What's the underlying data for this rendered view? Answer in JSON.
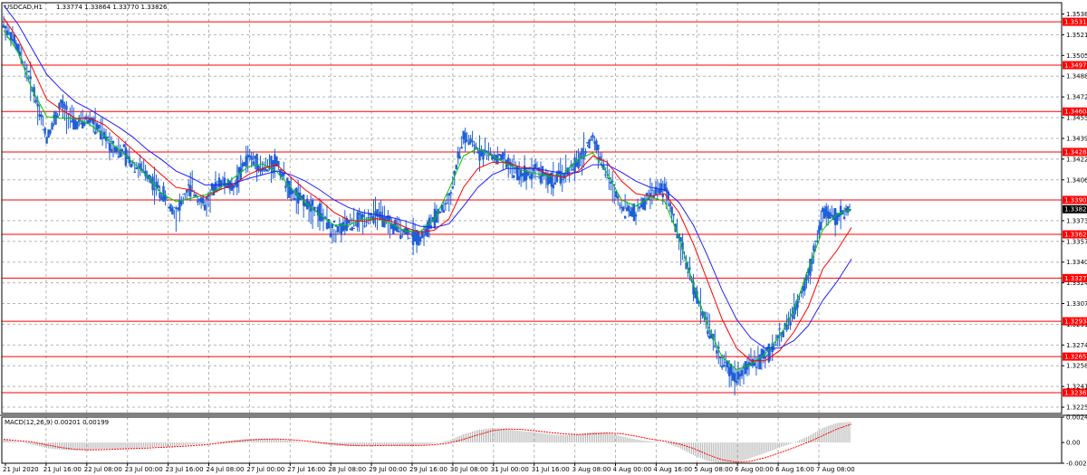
{
  "window": {
    "title": "USDCAD,H1",
    "ohlc": "1.33774 1.33864 1.33770 1.33826"
  },
  "macd": {
    "label": "MACD(12,26,9)",
    "values": "0.00201 0.00199",
    "ticks": [
      "0.00245",
      "0.00",
      "-0.00200"
    ]
  },
  "colors": {
    "background": "#ffffff",
    "grid": "#b4b4b4",
    "candle": "#1f5fd6",
    "level_line": "#ff0000",
    "ma_fast": "#00c800",
    "ma_mid": "#ff0000",
    "ma_slow": "#2020ff",
    "macd_hist": "#b4b4b4",
    "macd_signal": "#ff0000",
    "current_price_bg": "#000000"
  },
  "chart_data": {
    "type": "line",
    "title": "USDCAD,H1",
    "ylim": [
      1.322,
      1.3547
    ],
    "grid": true,
    "current_price": "1.33826",
    "y_ticks": [
      "1.35380",
      "1.35215",
      "1.35050",
      "1.34885",
      "1.34720",
      "1.34555",
      "1.34390",
      "1.34225",
      "1.34060",
      "1.33735",
      "1.33570",
      "1.33405",
      "1.33240",
      "1.33075",
      "1.32910",
      "1.32745",
      "1.32580",
      "1.32415",
      "1.32250"
    ],
    "level_labels": [
      "1.35318",
      "1.34973",
      "1.34604",
      "1.34282",
      "1.33900",
      "1.33626",
      "1.33278",
      "1.32934",
      "1.32653",
      "1.32366"
    ],
    "x_ticks": [
      "21 Jul 2020",
      "21 Jul 16:00",
      "22 Jul 08:00",
      "23 Jul 00:00",
      "23 Jul 16:00",
      "24 Jul 08:00",
      "27 Jul 00:00",
      "27 Jul 16:00",
      "28 Jul 08:00",
      "29 Jul 00:00",
      "29 Jul 16:00",
      "30 Jul 08:00",
      "31 Jul 00:00",
      "31 Jul 16:00",
      "3 Aug 08:00",
      "4 Aug 00:00",
      "4 Aug 16:00",
      "5 Aug 08:00",
      "6 Aug 00:00",
      "6 Aug 16:00",
      "7 Aug 08:00"
    ],
    "series": [
      {
        "values": [
          1.353,
          1.351,
          1.348,
          1.344,
          1.3465,
          1.345,
          1.3455,
          1.344,
          1.343,
          1.342,
          1.341,
          1.3395,
          1.338,
          1.34,
          1.3385,
          1.3405,
          1.34,
          1.3425,
          1.3415,
          1.342,
          1.3395,
          1.3388,
          1.338,
          1.3365,
          1.337,
          1.3375,
          1.3378,
          1.337,
          1.3365,
          1.336,
          1.3375,
          1.339,
          1.344,
          1.343,
          1.3425,
          1.342,
          1.341,
          1.3415,
          1.3405,
          1.341,
          1.342,
          1.344,
          1.341,
          1.3385,
          1.338,
          1.3395,
          1.34,
          1.336,
          1.332,
          1.329,
          1.326,
          1.325,
          1.326,
          1.3265,
          1.328,
          1.33,
          1.333,
          1.338,
          1.3375,
          1.3385
        ]
      },
      {
        "values": [
          1.3535,
          1.3518,
          1.3495,
          1.347,
          1.3462,
          1.3455,
          1.3455,
          1.345,
          1.344,
          1.343,
          1.342,
          1.341,
          1.34,
          1.3398,
          1.3392,
          1.3398,
          1.3402,
          1.341,
          1.3415,
          1.3418,
          1.3408,
          1.3398,
          1.339,
          1.338,
          1.3374,
          1.3373,
          1.3375,
          1.3373,
          1.3368,
          1.3364,
          1.3366,
          1.3375,
          1.34,
          1.3415,
          1.342,
          1.342,
          1.3416,
          1.3415,
          1.341,
          1.3408,
          1.3413,
          1.3425,
          1.342,
          1.3405,
          1.3395,
          1.3393,
          1.3395,
          1.338,
          1.3355,
          1.3325,
          1.3295,
          1.3272,
          1.3262,
          1.3262,
          1.327,
          1.3285,
          1.3305,
          1.3335,
          1.335,
          1.3368
        ]
      },
      {
        "values": [
          1.3545,
          1.353,
          1.351,
          1.349,
          1.3478,
          1.3468,
          1.3462,
          1.3455,
          1.3448,
          1.344,
          1.343,
          1.3422,
          1.3413,
          1.3408,
          1.3402,
          1.3402,
          1.3403,
          1.3407,
          1.341,
          1.3413,
          1.341,
          1.3405,
          1.3398,
          1.339,
          1.3384,
          1.338,
          1.3378,
          1.3376,
          1.3373,
          1.3369,
          1.3368,
          1.3371,
          1.3385,
          1.34,
          1.341,
          1.3415,
          1.3415,
          1.3415,
          1.3413,
          1.3411,
          1.3412,
          1.3418,
          1.3418,
          1.3412,
          1.3405,
          1.34,
          1.3398,
          1.3388,
          1.337,
          1.3345,
          1.3318,
          1.3295,
          1.328,
          1.3272,
          1.3272,
          1.3278,
          1.329,
          1.331,
          1.3325,
          1.3343
        ]
      }
    ],
    "macd_histogram": [
      0.0003,
      5e-05,
      -0.0002,
      -0.00055,
      -0.0007,
      -0.00075,
      -0.0007,
      -0.0006,
      -0.0006,
      -0.00055,
      -0.00045,
      -0.0004,
      -0.00035,
      -0.0002,
      -0.0001,
      0.0001,
      0.00025,
      0.00035,
      0.00035,
      0.0003,
      0.00015,
      0.0,
      -0.00015,
      -0.0003,
      -0.00035,
      -0.0003,
      -0.00025,
      -0.0003,
      -0.0003,
      -0.00025,
      -0.0001,
      0.0002,
      0.0008,
      0.0012,
      0.0014,
      0.0013,
      0.0011,
      0.001,
      0.0008,
      0.0007,
      0.0008,
      0.001,
      0.00095,
      0.0006,
      0.0003,
      0.0001,
      0.0,
      -0.0005,
      -0.0012,
      -0.0018,
      -0.002,
      -0.0019,
      -0.0015,
      -0.001,
      -0.0005,
      0.0,
      0.0006,
      0.0014,
      0.0019,
      0.00201
    ]
  }
}
